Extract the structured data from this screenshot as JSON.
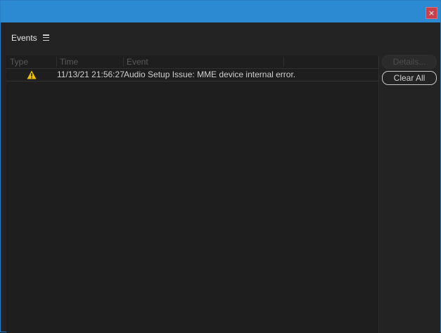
{
  "window": {
    "close_glyph": "×"
  },
  "panel": {
    "title": "Events"
  },
  "columns": {
    "type": "Type",
    "time": "Time",
    "event": "Event"
  },
  "rows": [
    {
      "type_icon": "warning-icon",
      "time": "11/13/21 21:56:27",
      "event": "Audio Setup Issue: MME device internal error."
    }
  ],
  "buttons": {
    "details": "Details...",
    "clear_all": "Clear All"
  },
  "colors": {
    "titlebar": "#2b8ad2",
    "close": "#c8414a",
    "warning": "#f2c200"
  }
}
